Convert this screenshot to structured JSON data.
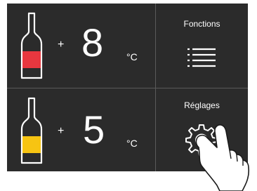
{
  "zones": [
    {
      "sign": "+",
      "temperature": "8",
      "unit": "°C",
      "bottle_label_color": "#e8373f"
    },
    {
      "sign": "+",
      "temperature": "5",
      "unit": "°C",
      "bottle_label_color": "#f7c412"
    }
  ],
  "buttons": {
    "functions_label": "Fonctions",
    "settings_label": "Réglages"
  },
  "icons": [
    "bottle-icon",
    "menu-icon",
    "gear-icon",
    "hand-pointer-icon"
  ],
  "colors": {
    "panel": "#2b2b2b",
    "divider": "#5a5a5a",
    "text": "#ffffff"
  }
}
